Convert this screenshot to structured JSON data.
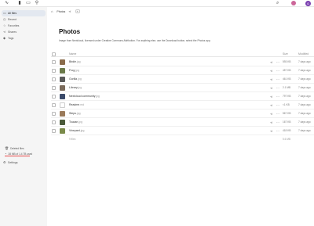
{
  "topbar": {
    "logo_icon": "∿",
    "apps": [
      "▮",
      "▭",
      "⚲"
    ],
    "search_icon": "⌕",
    "avatar_letter": "G"
  },
  "sidebar": {
    "items": [
      {
        "label": "All files",
        "icon": "▭",
        "active": true
      },
      {
        "label": "Recent",
        "icon": "◷",
        "active": false
      },
      {
        "label": "Favorites",
        "icon": "☆",
        "active": false
      },
      {
        "label": "Shares",
        "icon": "⋖",
        "active": false
      },
      {
        "label": "Tags",
        "icon": "◆",
        "active": false
      }
    ],
    "deleted_label": "Deleted files",
    "storage_text": "38 MB of 1.4 TB used",
    "settings_label": "Settings"
  },
  "breadcrumb": {
    "home_icon": "⌂",
    "current": "Photos",
    "share_icon": "⋖",
    "add_label": "+"
  },
  "page": {
    "title": "Photos",
    "description": "Image from Nextcloud, licensed under Creative Commons Attribution. For anything else, use the Download button, select the Photos app.",
    "columns": {
      "name": "Name",
      "size": "Size",
      "modified": "Modified"
    }
  },
  "files": [
    {
      "name": "Birdie",
      "ext": ".jpg",
      "size": "593 KB",
      "modified": "7 days ago",
      "thumb_color": "#8a6b4a",
      "type": "image"
    },
    {
      "name": "Frog",
      "ext": ".jpg",
      "size": "457 KB",
      "modified": "7 days ago",
      "thumb_color": "#6b7a4a",
      "type": "image"
    },
    {
      "name": "Gorilla",
      "ext": ".jpg",
      "size": "461 KB",
      "modified": "7 days ago",
      "thumb_color": "#5a5a5a",
      "type": "image"
    },
    {
      "name": "Library",
      "ext": ".jpg",
      "size": "2.1 MB",
      "modified": "7 days ago",
      "thumb_color": "#7a6a5a",
      "type": "image"
    },
    {
      "name": "Nextcloud community",
      "ext": ".jpg",
      "size": "797 KB",
      "modified": "7 days ago",
      "thumb_color": "#3a4a6a",
      "type": "image"
    },
    {
      "name": "Readme",
      "ext": ".md",
      "size": "<1 KB",
      "modified": "7 days ago",
      "thumb_color": "#ffffff",
      "type": "text"
    },
    {
      "name": "Steps",
      "ext": ".jpg",
      "size": "567 KB",
      "modified": "7 days ago",
      "thumb_color": "#9a7a5a",
      "type": "image"
    },
    {
      "name": "Toucan",
      "ext": ".jpg",
      "size": "167 KB",
      "modified": "7 days ago",
      "thumb_color": "#4a5a3a",
      "type": "image"
    },
    {
      "name": "Vineyard",
      "ext": ".jpg",
      "size": "418 KB",
      "modified": "7 days ago",
      "thumb_color": "#7a8a4a",
      "type": "image"
    }
  ],
  "totals": {
    "label": "9 files",
    "size": "5.6 MB"
  }
}
